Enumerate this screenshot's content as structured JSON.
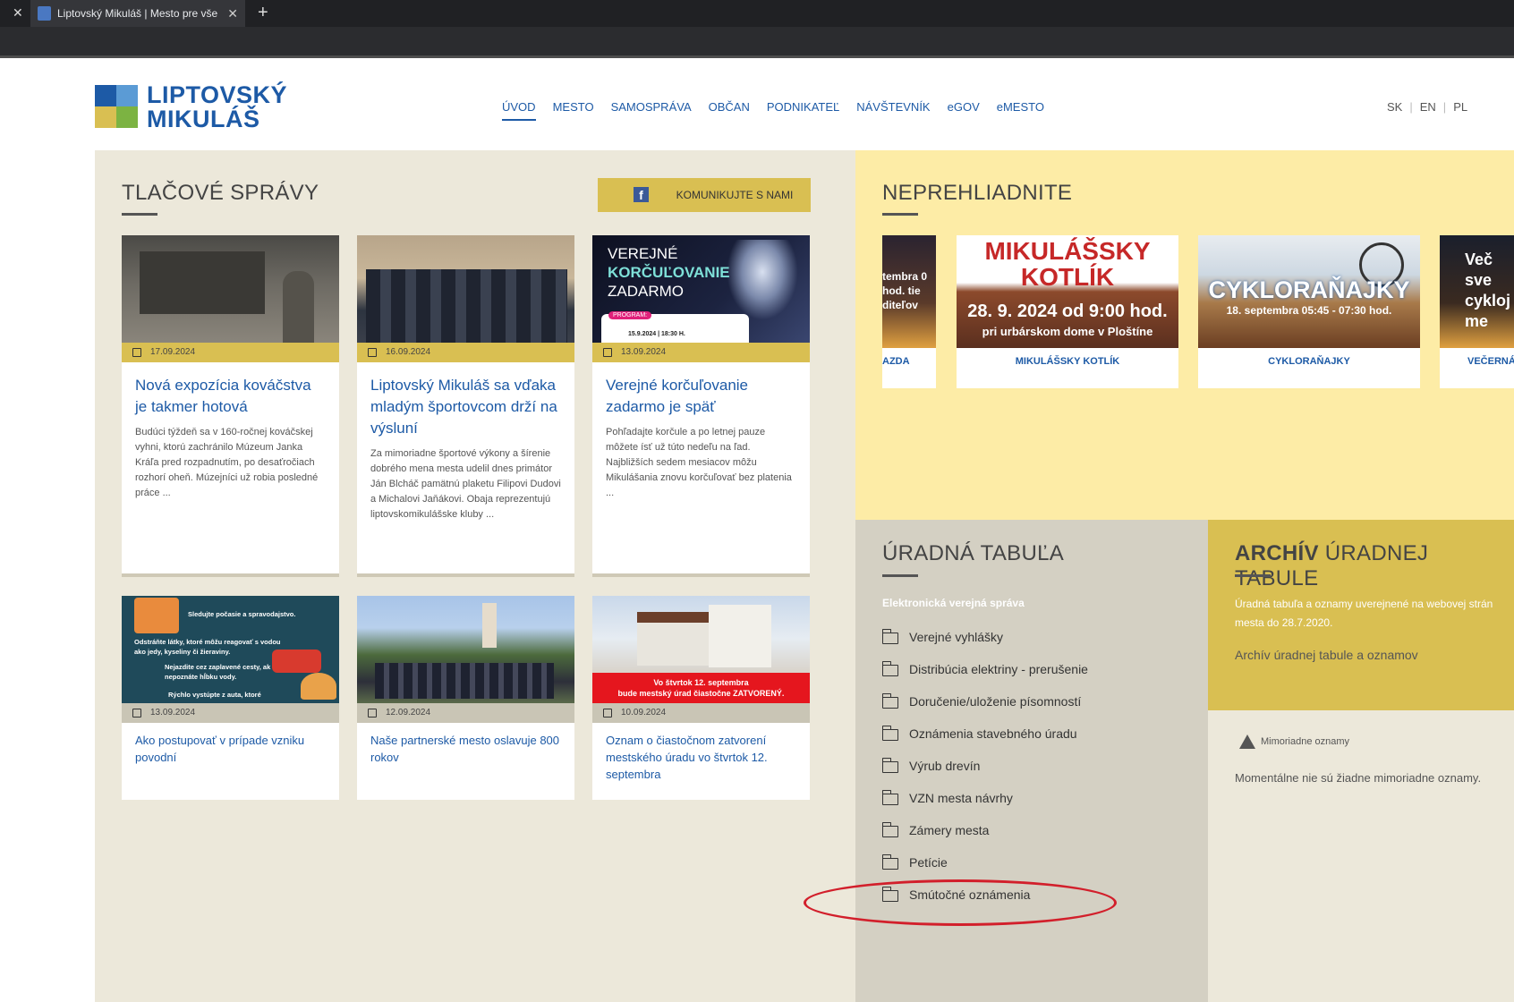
{
  "browser": {
    "tab_title": "Liptovský Mikuláš | Mesto pre vše",
    "new_tab": "+",
    "close": "✕"
  },
  "header": {
    "logo_line1": "LIPTOVSKÝ",
    "logo_line2": "MIKULÁŠ",
    "nav": [
      "ÚVOD",
      "MESTO",
      "SAMOSPRÁVA",
      "OBČAN",
      "PODNIKATEĽ",
      "NÁVŠTEVNÍK",
      "eGOV",
      "eMESTO"
    ],
    "langs": [
      "SK",
      "EN",
      "PL"
    ]
  },
  "press": {
    "title": "TLAČOVÉ SPRÁVY",
    "fb_button": "KOMUNIKUJTE S NAMI",
    "cards": [
      {
        "date": "17.09.2024",
        "title": "Nová expozícia kováčstva je takmer hotová",
        "desc": "Budúci týždeň sa v 160-ročnej kováčskej vyhni, ktorú zachránilo Múzeum Janka Kráľa pred rozpadnutím, po desaťročiach rozhorí oheň. Múzejníci už robia posledné práce ..."
      },
      {
        "date": "16.09.2024",
        "title": "Liptovský Mikuláš sa vďaka mladým športovcom drží na výsluní",
        "desc": "Za mimoriadne športové výkony a šírenie dobrého mena mesta udelil dnes primátor Ján Blcháč pamätnú plaketu Filipovi Dudovi a Michalovi Jaňákovi. Obaja reprezentujú liptovskomikulášske kluby ..."
      },
      {
        "date": "13.09.2024",
        "title": "Verejné korčuľovanie zadarmo je späť",
        "desc": "Pohľadajte korčule a po letnej pauze môžete ísť už túto nedeľu na ľad. Najbližších sedem mesiacov môžu Mikulášania znovu korčuľovať bez platenia ...",
        "img_text1": "VEREJNÉ",
        "img_text2": "KORČUĽOVANIE",
        "img_text3": "ZADARMO",
        "img_badge": "PROGRAM:",
        "img_small": "15.9.2024 | 18:30 H."
      },
      {
        "date": "13.09.2024",
        "title": "Ako postupovať v prípade vzniku povodní",
        "img_lines": [
          "Sledujte počasie a spravodajstvo.",
          "Odstráňte látky, ktoré môžu reagovať s vodou ako jedy, kyseliny či žieraviny.",
          "Nejazdite cez zaplavené cesty, ak nepoznáte hĺbku vody.",
          "Rýchlo vystúpte z auta, ktoré"
        ]
      },
      {
        "date": "12.09.2024",
        "title": "Naše partnerské mesto oslavuje 800 rokov"
      },
      {
        "date": "10.09.2024",
        "title": "Oznam o čiastočnom zatvorení mestského úradu vo štvrtok 12. septembra",
        "img_banner1": "Vo štvrtok 12. septembra",
        "img_banner2": "bude mestský úrad čiastočne ZATVORENÝ."
      }
    ]
  },
  "neprehliadnite": {
    "title": "NEPREHLIADNITE",
    "items": [
      {
        "label": "AZDA",
        "img_text": "tembra 0 hod. tie diteľov"
      },
      {
        "label": "MIKULÁŠSKY KOTLÍK",
        "img_title1": "MIKULÁŠSKY",
        "img_title2": "KOTLÍK",
        "img_date": "28. 9. 2024 od 9:00 hod.",
        "img_place": "pri urbárskom dome v Ploštíne"
      },
      {
        "label": "CYKLORAŇAJKY",
        "img_title": "CYKLORAŇAJKY",
        "img_sub": "18. septembra 05:45 - 07:30 hod."
      },
      {
        "label": "VEČERNÁ",
        "img_text": "Več sve cykloj me"
      }
    ]
  },
  "tabula": {
    "title": "ÚRADNÁ TABUĽA",
    "subtitle": "Elektronická verejná správa",
    "items": [
      "Verejné vyhlášky",
      "Distribúcia elektriny - prerušenie",
      "Doručenie/uloženie písomností",
      "Oznámenia stavebného úradu",
      "Výrub drevín",
      "VZN mesta návrhy",
      "Zámery mesta",
      "Petície",
      "Smútočné oznámenia"
    ]
  },
  "archiv": {
    "title_bold": "ARCHÍV",
    "title_rest": " ÚRADNEJ TABULE",
    "text": "Úradná tabuľa a oznamy uverejnené na webovej strán mesta do 28.7.2020.",
    "link": "Archív úradnej tabule a oznamov"
  },
  "mimoriadne": {
    "heading": "Mimoriadne oznamy",
    "text": "Momentálne nie sú žiadne mimoriadne oznamy."
  },
  "colors": {
    "accent_blue": "#1d5aa6",
    "gold": "#d9bf52",
    "yellow": "#fdeca6",
    "annotation_red": "#d21f2b"
  }
}
